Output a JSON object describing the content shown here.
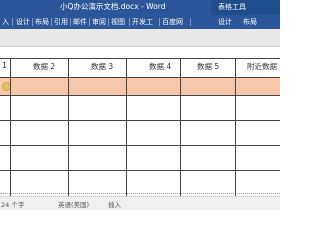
{
  "window": {
    "title": "小Q办公演示文档.docx - Word",
    "context_tab": "表格工具"
  },
  "ribbon": {
    "tabs": [
      "入",
      "设计",
      "布局",
      "引用",
      "邮件",
      "审阅",
      "视图",
      "开发工",
      "百度网",
      "设计",
      "布局"
    ]
  },
  "table": {
    "headers": [
      "1",
      "数据 2",
      "数据 3",
      "数据 4",
      "数据 5",
      "附近数据"
    ]
  },
  "status": {
    "word_count": "24 个字",
    "language": "英语(美国)",
    "mode": "插入"
  },
  "colors": {
    "accent": "#2b579a",
    "highlight_row": "#f6c8a9"
  }
}
